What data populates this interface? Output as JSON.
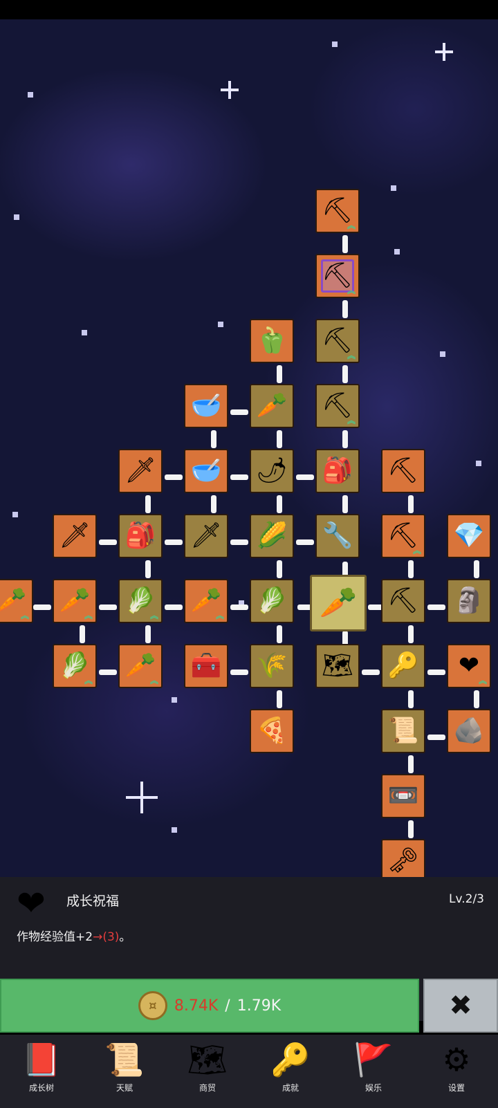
{
  "skill_tree": {
    "nodes": [
      {
        "icon": "shovel-icon",
        "glyph": "⛏",
        "style": "orange",
        "upgrade": true
      },
      {
        "icon": "purple-shovel-icon",
        "glyph": "⛏",
        "style": "purple-ring",
        "upgrade": true
      },
      {
        "icon": "bell-pepper-icon",
        "glyph": "🫑",
        "style": "orange",
        "upgrade": false
      },
      {
        "icon": "shovel-icon",
        "glyph": "⛏",
        "style": "olive",
        "upgrade": true
      },
      {
        "icon": "bowl-icon",
        "glyph": "🥣",
        "style": "orange",
        "upgrade": false
      },
      {
        "icon": "radish-icon",
        "glyph": "🥕",
        "style": "olive",
        "upgrade": false
      },
      {
        "icon": "shovel-icon",
        "glyph": "⛏",
        "style": "olive",
        "upgrade": true
      },
      {
        "icon": "sword-icon",
        "glyph": "🗡",
        "style": "orange",
        "upgrade": false
      },
      {
        "icon": "bowl-icon",
        "glyph": "🥣",
        "style": "orange",
        "upgrade": false
      },
      {
        "icon": "chili-icon",
        "glyph": "🌶",
        "style": "olive",
        "upgrade": false
      },
      {
        "icon": "backpack-icon",
        "glyph": "🎒",
        "style": "olive",
        "upgrade": false
      },
      {
        "icon": "pickaxe-icon",
        "glyph": "⛏",
        "style": "orange",
        "upgrade": false
      },
      {
        "icon": "sword-icon",
        "glyph": "🗡",
        "style": "orange",
        "upgrade": false
      },
      {
        "icon": "backpack-icon",
        "glyph": "🎒",
        "style": "olive",
        "upgrade": false
      },
      {
        "icon": "sword-icon",
        "glyph": "🗡",
        "style": "olive",
        "upgrade": false
      },
      {
        "icon": "corn-icon",
        "glyph": "🌽",
        "style": "olive",
        "upgrade": false
      },
      {
        "icon": "hoe-icon",
        "glyph": "🔧",
        "style": "olive",
        "upgrade": false
      },
      {
        "icon": "pickaxe-icon",
        "glyph": "⛏",
        "style": "orange",
        "upgrade": true
      },
      {
        "icon": "crystal-icon",
        "glyph": "💎",
        "style": "orange",
        "upgrade": false
      },
      {
        "icon": "carrot-icon",
        "glyph": "🥕",
        "style": "orange",
        "upgrade": true
      },
      {
        "icon": "carrot-icon",
        "glyph": "🥕",
        "style": "orange",
        "upgrade": true
      },
      {
        "icon": "cabbage-icon",
        "glyph": "🥬",
        "style": "olive",
        "upgrade": true
      },
      {
        "icon": "carrot-icon",
        "glyph": "🥕",
        "style": "orange",
        "upgrade": true
      },
      {
        "icon": "cabbage-icon",
        "glyph": "🥬",
        "style": "olive",
        "upgrade": false
      },
      {
        "icon": "carrot-icon",
        "glyph": "🥕",
        "style": "selected",
        "upgrade": false
      },
      {
        "icon": "pickaxe-icon",
        "glyph": "⛏",
        "style": "olive",
        "upgrade": false
      },
      {
        "icon": "statue-icon",
        "glyph": "🗿",
        "style": "olive",
        "upgrade": false
      },
      {
        "icon": "cabbage-icon",
        "glyph": "🥬",
        "style": "orange",
        "upgrade": true
      },
      {
        "icon": "carrot-icon",
        "glyph": "🥕",
        "style": "orange",
        "upgrade": true
      },
      {
        "icon": "chest-icon",
        "glyph": "🧰",
        "style": "orange",
        "upgrade": false
      },
      {
        "icon": "parsnip-icon",
        "glyph": "🌾",
        "style": "olive",
        "upgrade": false
      },
      {
        "icon": "map-icon",
        "glyph": "🗺",
        "style": "olive",
        "upgrade": false
      },
      {
        "icon": "key-icon",
        "glyph": "🔑",
        "style": "olive",
        "upgrade": false
      },
      {
        "icon": "heart-icon",
        "glyph": "❤",
        "style": "orange",
        "upgrade": true
      },
      {
        "icon": "pizza-icon",
        "glyph": "🍕",
        "style": "orange",
        "upgrade": false
      },
      {
        "icon": "scroll-icon",
        "glyph": "📜",
        "style": "olive",
        "upgrade": false
      },
      {
        "icon": "fossil-icon",
        "glyph": "🪨",
        "style": "orange",
        "upgrade": false
      },
      {
        "icon": "cassette-icon",
        "glyph": "📼",
        "style": "orange",
        "upgrade": false
      },
      {
        "icon": "dark-key-icon",
        "glyph": "🗝",
        "style": "orange",
        "upgrade": false
      }
    ]
  },
  "info_panel": {
    "icon": "heart-icon",
    "title": "成长祝福",
    "level": "Lv.2/3",
    "desc_prefix": "作物经验值+2",
    "desc_arrow": "→",
    "desc_next": "(3)",
    "desc_suffix": "。"
  },
  "upgrade": {
    "coin_icon": "coin-icon",
    "current": "8.74K",
    "separator": "/",
    "required": "1.79K",
    "close_icon": "close-icon",
    "close_glyph": "✖"
  },
  "nav": [
    {
      "label": "成长树",
      "icon": "book-icon",
      "glyph": "📕"
    },
    {
      "label": "天赋",
      "icon": "scroll-icon",
      "glyph": "📜"
    },
    {
      "label": "商贸",
      "icon": "map-icon",
      "glyph": "🗺"
    },
    {
      "label": "成就",
      "icon": "key-icon",
      "glyph": "🔑"
    },
    {
      "label": "娱乐",
      "icon": "banner-icon",
      "glyph": "🚩"
    },
    {
      "label": "设置",
      "icon": "gear-icon",
      "glyph": "⚙"
    }
  ],
  "colors": {
    "orange_node": "#d9743a",
    "olive_node": "#9a8141",
    "upgrade_green": "#58b86a",
    "cost_red": "#d83b2b"
  }
}
